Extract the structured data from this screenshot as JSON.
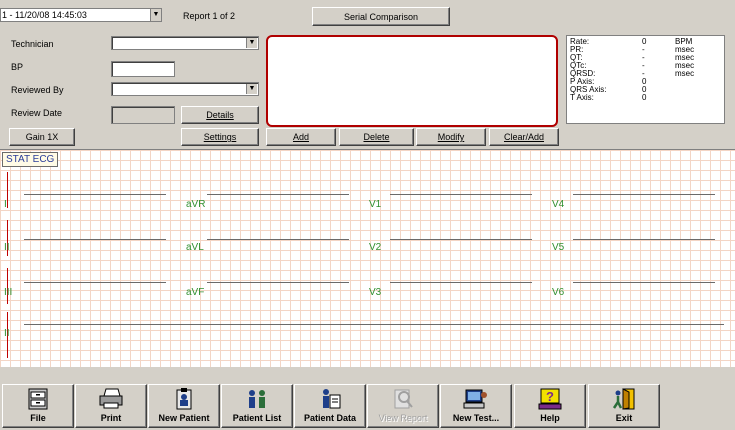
{
  "topbar": {
    "report_selected": "1 - 11/20/08 14:45:03",
    "report_count": "Report 1 of 2",
    "serial_comparison": "Serial Comparison"
  },
  "form": {
    "technician_label": "Technician",
    "bp_label": "BP",
    "reviewed_by_label": "Reviewed By",
    "review_date_label": "Review Date",
    "details_label": "Details",
    "gain_label": "Gain 1X",
    "settings_label": "Settings"
  },
  "actions": {
    "add": "Add",
    "delete": "Delete",
    "modify": "Modify",
    "clear_add": "Clear/Add"
  },
  "measurements": [
    {
      "label": "Rate:",
      "value": "0",
      "unit": "BPM"
    },
    {
      "label": "PR:",
      "value": "-",
      "unit": "msec"
    },
    {
      "label": "QT:",
      "value": "-",
      "unit": "msec"
    },
    {
      "label": "QTc:",
      "value": "-",
      "unit": "msec"
    },
    {
      "label": "QRSD:",
      "value": "-",
      "unit": "msec"
    },
    {
      "label": "P Axis:",
      "value": "0",
      "unit": ""
    },
    {
      "label": "QRS Axis:",
      "value": "0",
      "unit": ""
    },
    {
      "label": "T Axis:",
      "value": "0",
      "unit": ""
    }
  ],
  "ecg": {
    "tab": "STAT ECG",
    "leads": {
      "i": "I",
      "ii": "II",
      "iii": "III",
      "rhythm": "II",
      "avr": "aVR",
      "avl": "aVL",
      "avf": "aVF",
      "v1": "V1",
      "v2": "V2",
      "v3": "V3",
      "v4": "V4",
      "v5": "V5",
      "v6": "V6"
    }
  },
  "toolbar": {
    "file": "File",
    "print": "Print",
    "new_patient": "New Patient",
    "patient_list": "Patient List",
    "patient_data": "Patient Data",
    "view_report": "View Report",
    "new_test": "New Test...",
    "help": "Help",
    "exit": "Exit"
  },
  "colors": {
    "window_bg": "#d4d0c8",
    "notes_border": "#b00000",
    "grid": "#f3d5c5",
    "lead_label": "#2f8f2f",
    "stat_tab_text": "#2a3d9a"
  }
}
